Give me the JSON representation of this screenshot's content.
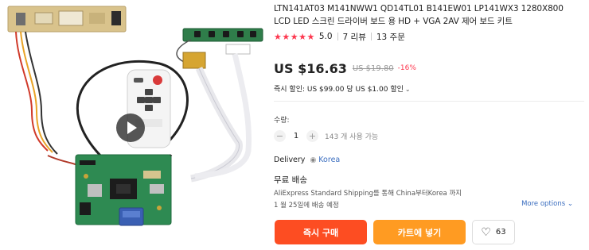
{
  "product": {
    "title": "LTN141AT03 M141NWW1 QD14TL01 B141EW01 LP141WX3 1280X800 LCD LED 스크린 드라이버 보드 용 HD + VGA 2AV 제어 보드 키트",
    "stars": "★★★★★",
    "rating": "5.0",
    "reviews": "7 리뷰",
    "orders": "13 주문"
  },
  "price": {
    "current": "US $16.63",
    "original": "US $19.80",
    "discount": "-16%"
  },
  "coupon": {
    "text": "즉시 할인: US $99.00 당 US $1.00 할인"
  },
  "quantity": {
    "label": "수량:",
    "value": "1",
    "minus": "−",
    "plus": "+",
    "stock": "143 개 사용 가능"
  },
  "delivery": {
    "label": "Delivery",
    "country": "Korea"
  },
  "shipping": {
    "title": "무료 배송",
    "description": "AliExpress Standard Shipping를 통해 China부터Korea 까지",
    "date": "1 월 25일에 배송 예정",
    "more_options": "More options"
  },
  "actions": {
    "buy_now": "즉시 구매",
    "add_to_cart": "카트에 넣기",
    "wishlist_count": "63"
  },
  "icons": {
    "play": "play-icon",
    "pin": "location-pin-icon",
    "heart": "heart-icon",
    "chevron": "chevron-down-icon"
  },
  "colors": {
    "accent": "#fd384f",
    "buy": "#fd4d22",
    "cart": "#ff9b22",
    "link": "#3a6dbf"
  }
}
